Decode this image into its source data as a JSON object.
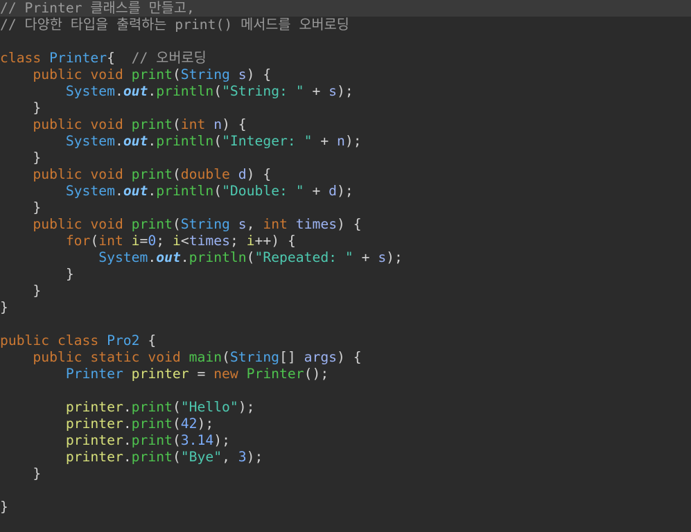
{
  "editor": {
    "language": "java",
    "colors": {
      "background": "#2b2b2b",
      "highlight_line": "#3a3a3a",
      "kw": "#cc7832",
      "type": "#4ea5e8",
      "method": "#4ec34e",
      "param": "#9cb3f3",
      "str": "#4ec9b0",
      "num": "#7dadfa",
      "comment": "#9a9a9a",
      "field": "#80c4ff",
      "var": "#d7e07a",
      "plain": "#d4d4d4"
    },
    "lines": [
      {
        "highlighted": true,
        "tokens": [
          {
            "t": "// Printer 클래스를 만들고,",
            "k": "comment"
          }
        ]
      },
      {
        "tokens": [
          {
            "t": "// 다양한 타입을 출력하는 ",
            "k": "comment"
          },
          {
            "t": "print()",
            "k": "comment"
          },
          {
            "t": " 메서드를 오버로딩",
            "k": "comment"
          }
        ]
      },
      {
        "tokens": []
      },
      {
        "tokens": [
          {
            "t": "class ",
            "k": "kw"
          },
          {
            "t": "Printer",
            "k": "type"
          },
          {
            "t": "{  ",
            "k": "plain"
          },
          {
            "t": "// 오버로딩",
            "k": "comment"
          }
        ]
      },
      {
        "tokens": [
          {
            "t": "    ",
            "k": "plain"
          },
          {
            "t": "public void ",
            "k": "kw"
          },
          {
            "t": "print",
            "k": "method"
          },
          {
            "t": "(",
            "k": "plain"
          },
          {
            "t": "String ",
            "k": "type"
          },
          {
            "t": "s",
            "k": "param"
          },
          {
            "t": ") {",
            "k": "plain"
          }
        ]
      },
      {
        "tokens": [
          {
            "t": "        ",
            "k": "plain"
          },
          {
            "t": "System",
            "k": "type"
          },
          {
            "t": ".",
            "k": "plain"
          },
          {
            "t": "out",
            "k": "field"
          },
          {
            "t": ".",
            "k": "plain"
          },
          {
            "t": "println",
            "k": "method"
          },
          {
            "t": "(",
            "k": "plain"
          },
          {
            "t": "\"String: \"",
            "k": "str"
          },
          {
            "t": " + ",
            "k": "plain"
          },
          {
            "t": "s",
            "k": "param"
          },
          {
            "t": ");",
            "k": "plain"
          }
        ]
      },
      {
        "tokens": [
          {
            "t": "    }",
            "k": "plain"
          }
        ]
      },
      {
        "tokens": [
          {
            "t": "    ",
            "k": "plain"
          },
          {
            "t": "public void ",
            "k": "kw"
          },
          {
            "t": "print",
            "k": "method"
          },
          {
            "t": "(",
            "k": "plain"
          },
          {
            "t": "int ",
            "k": "kw"
          },
          {
            "t": "n",
            "k": "param"
          },
          {
            "t": ") {",
            "k": "plain"
          }
        ]
      },
      {
        "tokens": [
          {
            "t": "        ",
            "k": "plain"
          },
          {
            "t": "System",
            "k": "type"
          },
          {
            "t": ".",
            "k": "plain"
          },
          {
            "t": "out",
            "k": "field"
          },
          {
            "t": ".",
            "k": "plain"
          },
          {
            "t": "println",
            "k": "method"
          },
          {
            "t": "(",
            "k": "plain"
          },
          {
            "t": "\"Integer: \"",
            "k": "str"
          },
          {
            "t": " + ",
            "k": "plain"
          },
          {
            "t": "n",
            "k": "param"
          },
          {
            "t": ");",
            "k": "plain"
          }
        ]
      },
      {
        "tokens": [
          {
            "t": "    }",
            "k": "plain"
          }
        ]
      },
      {
        "tokens": [
          {
            "t": "    ",
            "k": "plain"
          },
          {
            "t": "public void ",
            "k": "kw"
          },
          {
            "t": "print",
            "k": "method"
          },
          {
            "t": "(",
            "k": "plain"
          },
          {
            "t": "double ",
            "k": "kw"
          },
          {
            "t": "d",
            "k": "param"
          },
          {
            "t": ") {",
            "k": "plain"
          }
        ]
      },
      {
        "tokens": [
          {
            "t": "        ",
            "k": "plain"
          },
          {
            "t": "System",
            "k": "type"
          },
          {
            "t": ".",
            "k": "plain"
          },
          {
            "t": "out",
            "k": "field"
          },
          {
            "t": ".",
            "k": "plain"
          },
          {
            "t": "println",
            "k": "method"
          },
          {
            "t": "(",
            "k": "plain"
          },
          {
            "t": "\"Double: \"",
            "k": "str"
          },
          {
            "t": " + ",
            "k": "plain"
          },
          {
            "t": "d",
            "k": "param"
          },
          {
            "t": ");",
            "k": "plain"
          }
        ]
      },
      {
        "tokens": [
          {
            "t": "    }",
            "k": "plain"
          }
        ]
      },
      {
        "tokens": [
          {
            "t": "    ",
            "k": "plain"
          },
          {
            "t": "public void ",
            "k": "kw"
          },
          {
            "t": "print",
            "k": "method"
          },
          {
            "t": "(",
            "k": "plain"
          },
          {
            "t": "String ",
            "k": "type"
          },
          {
            "t": "s",
            "k": "param"
          },
          {
            "t": ", ",
            "k": "plain"
          },
          {
            "t": "int ",
            "k": "kw"
          },
          {
            "t": "times",
            "k": "param"
          },
          {
            "t": ") {",
            "k": "plain"
          }
        ]
      },
      {
        "tokens": [
          {
            "t": "        ",
            "k": "plain"
          },
          {
            "t": "for",
            "k": "kw"
          },
          {
            "t": "(",
            "k": "plain"
          },
          {
            "t": "int ",
            "k": "kw"
          },
          {
            "t": "i",
            "k": "var"
          },
          {
            "t": "=",
            "k": "plain"
          },
          {
            "t": "0",
            "k": "num"
          },
          {
            "t": "; ",
            "k": "plain"
          },
          {
            "t": "i",
            "k": "var"
          },
          {
            "t": "<",
            "k": "plain"
          },
          {
            "t": "times",
            "k": "param"
          },
          {
            "t": "; ",
            "k": "plain"
          },
          {
            "t": "i",
            "k": "var"
          },
          {
            "t": "++) {",
            "k": "plain"
          }
        ]
      },
      {
        "tokens": [
          {
            "t": "            ",
            "k": "plain"
          },
          {
            "t": "System",
            "k": "type"
          },
          {
            "t": ".",
            "k": "plain"
          },
          {
            "t": "out",
            "k": "field"
          },
          {
            "t": ".",
            "k": "plain"
          },
          {
            "t": "println",
            "k": "method"
          },
          {
            "t": "(",
            "k": "plain"
          },
          {
            "t": "\"Repeated: \"",
            "k": "str"
          },
          {
            "t": " + ",
            "k": "plain"
          },
          {
            "t": "s",
            "k": "param"
          },
          {
            "t": ");",
            "k": "plain"
          }
        ]
      },
      {
        "tokens": [
          {
            "t": "        }",
            "k": "plain"
          }
        ]
      },
      {
        "tokens": [
          {
            "t": "    }",
            "k": "plain"
          }
        ]
      },
      {
        "tokens": [
          {
            "t": "}",
            "k": "plain"
          }
        ]
      },
      {
        "tokens": []
      },
      {
        "tokens": [
          {
            "t": "public class ",
            "k": "kw"
          },
          {
            "t": "Pro2",
            "k": "type"
          },
          {
            "t": " {",
            "k": "plain"
          }
        ]
      },
      {
        "tokens": [
          {
            "t": "    ",
            "k": "plain"
          },
          {
            "t": "public static void ",
            "k": "kw"
          },
          {
            "t": "main",
            "k": "method"
          },
          {
            "t": "(",
            "k": "plain"
          },
          {
            "t": "String",
            "k": "type"
          },
          {
            "t": "[] ",
            "k": "plain"
          },
          {
            "t": "args",
            "k": "param"
          },
          {
            "t": ") {",
            "k": "plain"
          }
        ]
      },
      {
        "tokens": [
          {
            "t": "        ",
            "k": "plain"
          },
          {
            "t": "Printer ",
            "k": "type"
          },
          {
            "t": "printer",
            "k": "var"
          },
          {
            "t": " = ",
            "k": "plain"
          },
          {
            "t": "new ",
            "k": "kw"
          },
          {
            "t": "Printer",
            "k": "method"
          },
          {
            "t": "();",
            "k": "plain"
          }
        ]
      },
      {
        "tokens": []
      },
      {
        "tokens": [
          {
            "t": "        ",
            "k": "plain"
          },
          {
            "t": "printer",
            "k": "var"
          },
          {
            "t": ".",
            "k": "plain"
          },
          {
            "t": "print",
            "k": "method"
          },
          {
            "t": "(",
            "k": "plain"
          },
          {
            "t": "\"Hello\"",
            "k": "str"
          },
          {
            "t": ");",
            "k": "plain"
          }
        ]
      },
      {
        "tokens": [
          {
            "t": "        ",
            "k": "plain"
          },
          {
            "t": "printer",
            "k": "var"
          },
          {
            "t": ".",
            "k": "plain"
          },
          {
            "t": "print",
            "k": "method"
          },
          {
            "t": "(",
            "k": "plain"
          },
          {
            "t": "42",
            "k": "num"
          },
          {
            "t": ");",
            "k": "plain"
          }
        ]
      },
      {
        "tokens": [
          {
            "t": "        ",
            "k": "plain"
          },
          {
            "t": "printer",
            "k": "var"
          },
          {
            "t": ".",
            "k": "plain"
          },
          {
            "t": "print",
            "k": "method"
          },
          {
            "t": "(",
            "k": "plain"
          },
          {
            "t": "3.14",
            "k": "num"
          },
          {
            "t": ");",
            "k": "plain"
          }
        ]
      },
      {
        "tokens": [
          {
            "t": "        ",
            "k": "plain"
          },
          {
            "t": "printer",
            "k": "var"
          },
          {
            "t": ".",
            "k": "plain"
          },
          {
            "t": "print",
            "k": "method"
          },
          {
            "t": "(",
            "k": "plain"
          },
          {
            "t": "\"Bye\"",
            "k": "str"
          },
          {
            "t": ", ",
            "k": "plain"
          },
          {
            "t": "3",
            "k": "num"
          },
          {
            "t": ");",
            "k": "plain"
          }
        ]
      },
      {
        "tokens": [
          {
            "t": "    }",
            "k": "plain"
          }
        ]
      },
      {
        "tokens": []
      },
      {
        "tokens": [
          {
            "t": "}",
            "k": "plain"
          }
        ]
      }
    ]
  }
}
